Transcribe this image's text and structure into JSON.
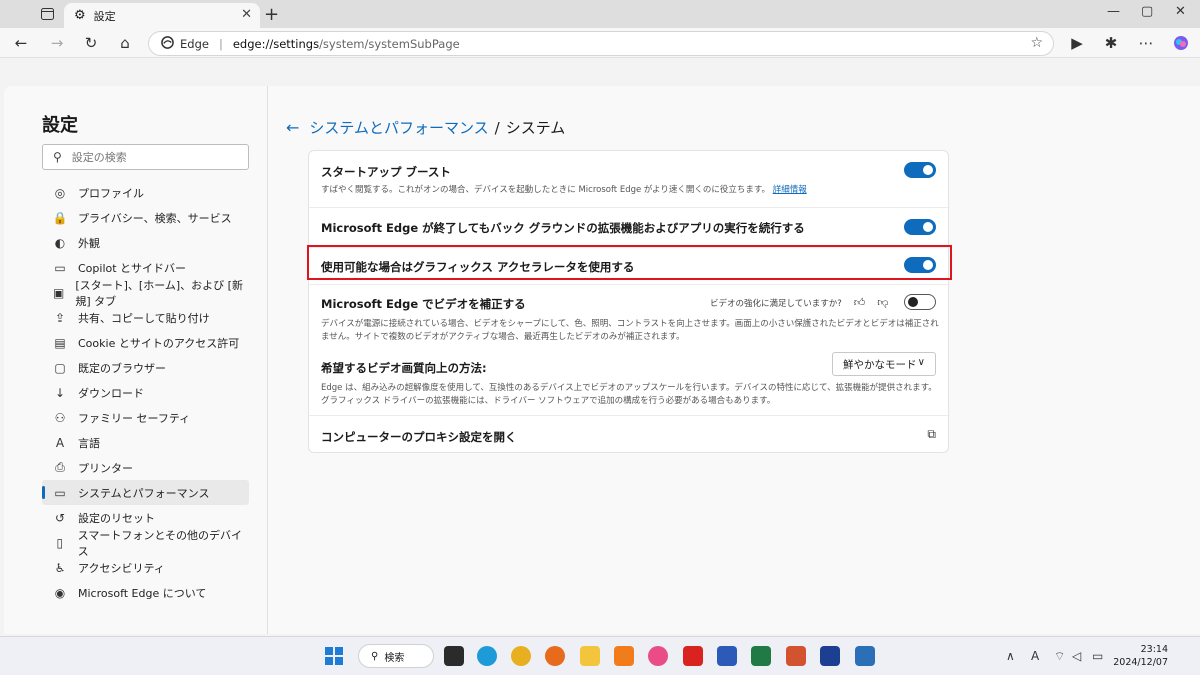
{
  "browser": {
    "tab_title": "設定",
    "omnibox_label": "Edge",
    "url_host": "edge://settings",
    "url_path": "/system/systemSubPage"
  },
  "sidebar": {
    "title": "設定",
    "search_placeholder": "設定の検索",
    "items": [
      {
        "label": "プロファイル",
        "icon": "profile-icon",
        "glyph": "◎"
      },
      {
        "label": "プライバシー、検索、サービス",
        "icon": "lock-icon",
        "glyph": "🔒"
      },
      {
        "label": "外観",
        "icon": "appearance-icon",
        "glyph": "◐"
      },
      {
        "label": "Copilot とサイドバー",
        "icon": "sidebar-icon",
        "glyph": "▭"
      },
      {
        "label": "[スタート]、[ホーム]、および [新規] タブ",
        "icon": "home-tab-icon",
        "glyph": "▣"
      },
      {
        "label": "共有、コピーして貼り付け",
        "icon": "share-icon",
        "glyph": "⇪"
      },
      {
        "label": "Cookie とサイトのアクセス許可",
        "icon": "cookie-icon",
        "glyph": "▤"
      },
      {
        "label": "既定のブラウザー",
        "icon": "browser-icon",
        "glyph": "▢"
      },
      {
        "label": "ダウンロード",
        "icon": "download-icon",
        "glyph": "↓"
      },
      {
        "label": "ファミリー セーフティ",
        "icon": "family-icon",
        "glyph": "⚇"
      },
      {
        "label": "言語",
        "icon": "language-icon",
        "glyph": "A"
      },
      {
        "label": "プリンター",
        "icon": "printer-icon",
        "glyph": "⎙"
      },
      {
        "label": "システムとパフォーマンス",
        "icon": "laptop-icon",
        "glyph": "▭",
        "active": true
      },
      {
        "label": "設定のリセット",
        "icon": "reset-icon",
        "glyph": "↺"
      },
      {
        "label": "スマートフォンとその他のデバイス",
        "icon": "phone-icon",
        "glyph": "▯"
      },
      {
        "label": "アクセシビリティ",
        "icon": "accessibility-icon",
        "glyph": "♿"
      },
      {
        "label": "Microsoft Edge について",
        "icon": "edge-logo-icon",
        "glyph": "◉"
      }
    ]
  },
  "content": {
    "breadcrumb_parent": "システムとパフォーマンス",
    "breadcrumb_sep": "/",
    "breadcrumb_current": "システム",
    "startup_boost": {
      "title": "スタートアップ ブースト",
      "desc": "すばやく閲覧する。これがオンの場合、デバイスを起動したときに Microsoft Edge がより速く開くのに役立ちます。",
      "link": "詳細情報",
      "enabled": true
    },
    "background": {
      "title": "Microsoft Edge が終了してもバック グラウンドの拡張機能およびアプリの実行を続行する",
      "enabled": true
    },
    "gpu": {
      "title": "使用可能な場合はグラフィックス アクセラレータを使用する",
      "enabled": true
    },
    "video": {
      "title": "Microsoft Edge でビデオを補正する",
      "feedback": "ビデオの強化に満足していますか?",
      "desc": "デバイスが電源に接続されている場合、ビデオをシャープにして、色、照明、コントラストを向上させます。画面上の小さい保護されたビデオとビデオは補正されません。サイトで複数のビデオがアクティブな場合、最近再生したビデオのみが補正されます。",
      "enabled": false
    },
    "upscale": {
      "title": "希望するビデオ画質向上の方法:",
      "dropdown": "鮮やかなモード",
      "desc": "Edge は、組み込みの超解像度を使用して、互換性のあるデバイス上でビデオのアップスケールを行います。デバイスの特性に応じて、拡張機能が提供されます。グラフィックス ドライバーの拡張機能には、ドライバー ソフトウェアで追加の構成を行う必要がある場合もあります。"
    },
    "proxy": {
      "title": "コンピューターのプロキシ設定を開く"
    }
  },
  "taskbar": {
    "search_label": "検索",
    "time": "23:14",
    "date": "2024/12/07"
  },
  "colors": {
    "accent": "#0f6cbd",
    "highlight": "#e0141e"
  }
}
